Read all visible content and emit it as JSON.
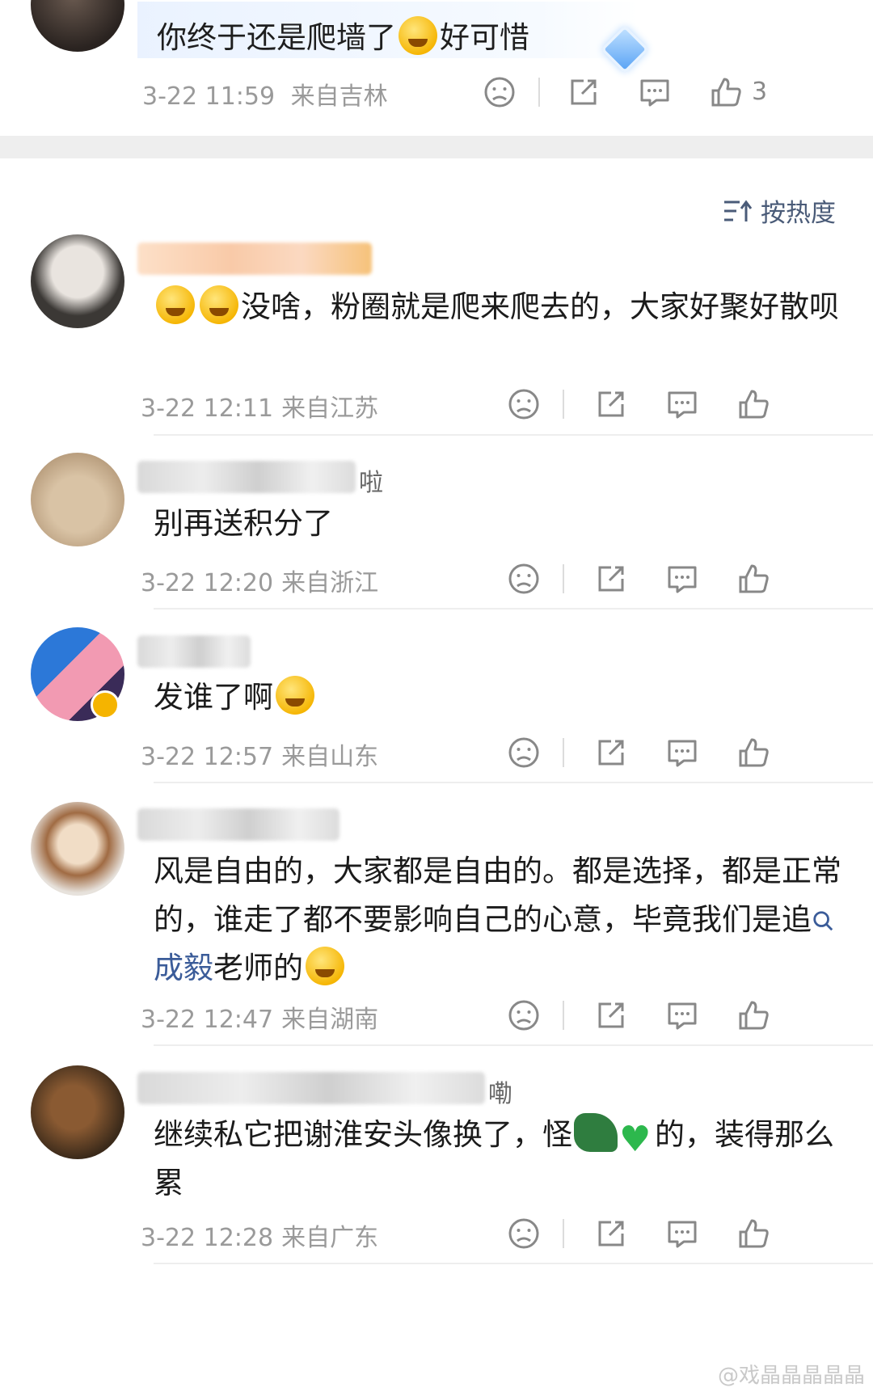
{
  "top_post": {
    "text_before": "你终于还是爬墙了",
    "text_after": "好可惜",
    "time": "3-22 11:59",
    "location": "来自吉林",
    "like_count": "3"
  },
  "sort": {
    "label": "按热度"
  },
  "comments": [
    {
      "username_fragment": "",
      "parts": [
        {
          "t": "emoji"
        },
        {
          "t": "emoji"
        },
        {
          "t": "text",
          "v": "没啥，粉圈就是爬来爬去的，大家好聚好散呗"
        }
      ],
      "time": "3-22 12:11",
      "location": "来自江苏"
    },
    {
      "username_fragment": "啦",
      "parts": [
        {
          "t": "text",
          "v": "别再送积分了"
        }
      ],
      "time": "3-22 12:20",
      "location": "来自浙江"
    },
    {
      "username_fragment": "",
      "parts": [
        {
          "t": "text",
          "v": "发谁了啊"
        },
        {
          "t": "emoji"
        }
      ],
      "time": "3-22 12:57",
      "location": "来自山东"
    },
    {
      "username_fragment": "",
      "parts": [
        {
          "t": "text",
          "v": "风是自由的，大家都是自由的。都是选择，都是正常的，谁走了都不要影响自己的心意，毕竟我们是追"
        },
        {
          "t": "link",
          "v": "成毅"
        },
        {
          "t": "text",
          "v": "老师的"
        },
        {
          "t": "emoji"
        }
      ],
      "time": "3-22 12:47",
      "location": "来自湖南"
    },
    {
      "username_fragment": "嘞",
      "parts": [
        {
          "t": "text",
          "v": "继续私它把谢淮安头像换了，怪"
        },
        {
          "t": "croc"
        },
        {
          "t": "heart"
        },
        {
          "t": "text",
          "v": "的，装得那么累"
        }
      ],
      "time": "3-22 12:28",
      "location": "来自广东"
    }
  ],
  "watermark": "@戏晶晶晶晶晶",
  "icons": [
    "dislike-icon",
    "share-icon",
    "comment-icon",
    "like-icon",
    "sort-icon"
  ],
  "colors": {
    "link": "#3b5c99",
    "meta": "#9a9a9a",
    "band": "#eeeeee"
  }
}
